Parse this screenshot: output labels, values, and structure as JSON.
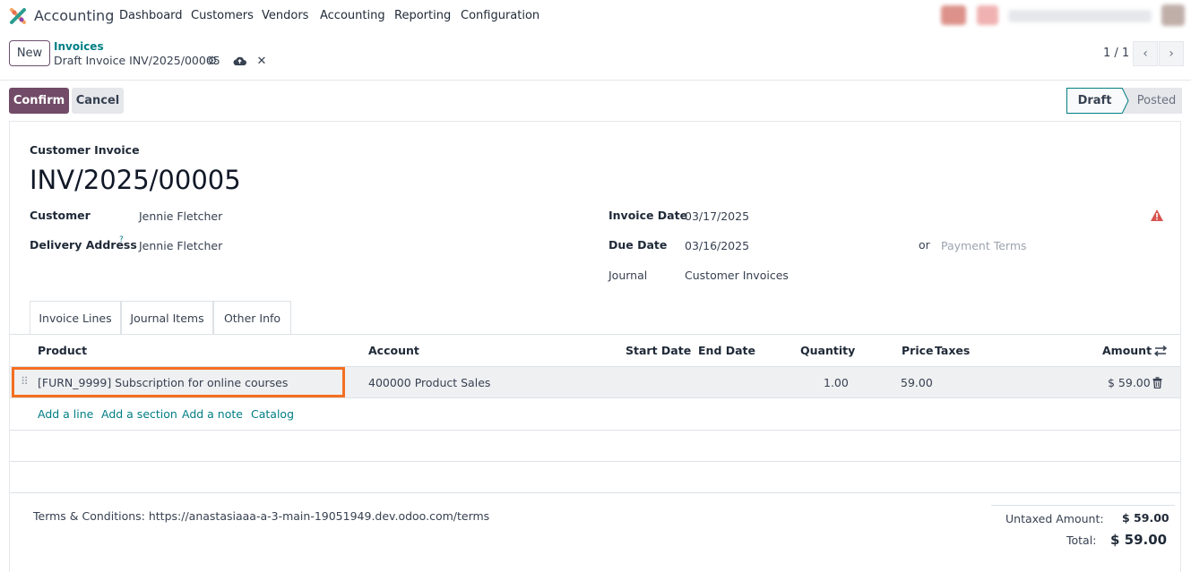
{
  "app": {
    "name": "Accounting",
    "menu": [
      "Dashboard",
      "Customers",
      "Vendors",
      "Accounting",
      "Reporting",
      "Configuration"
    ]
  },
  "control_panel": {
    "new_label": "New",
    "breadcrumb_parent": "Invoices",
    "breadcrumb_current": "Draft Invoice INV/2025/00005",
    "pager": "1 / 1"
  },
  "actions": {
    "confirm_label": "Confirm",
    "cancel_label": "Cancel",
    "status_draft": "Draft",
    "status_posted": "Posted"
  },
  "invoice": {
    "type_label": "Customer Invoice",
    "number": "INV/2025/00005",
    "customer_label": "Customer",
    "customer": "Jennie Fletcher",
    "delivery_label": "Delivery Address",
    "delivery_help": "?",
    "delivery": "Jennie Fletcher",
    "invoice_date_label": "Invoice Date",
    "invoice_date": "03/17/2025",
    "due_date_label": "Due Date",
    "due_date": "03/16/2025",
    "or_text": "or",
    "payment_terms_placeholder": "Payment Terms",
    "journal_label": "Journal",
    "journal": "Customer Invoices"
  },
  "tabs": [
    "Invoice Lines",
    "Journal Items",
    "Other Info"
  ],
  "lines": {
    "headers": {
      "product": "Product",
      "account": "Account",
      "start_date": "Start Date",
      "end_date": "End Date",
      "quantity": "Quantity",
      "price": "Price",
      "taxes": "Taxes",
      "amount": "Amount"
    },
    "rows": [
      {
        "product": "[FURN_9999] Subscription for online courses",
        "account": "400000 Product Sales",
        "start_date": "",
        "end_date": "",
        "quantity": "1.00",
        "price": "59.00",
        "taxes": "",
        "amount": "$ 59.00"
      }
    ],
    "add_links": [
      "Add a line",
      "Add a section",
      "Add a note",
      "Catalog"
    ]
  },
  "footer": {
    "terms": "Terms & Conditions: https://anastasiaaa-a-3-main-19051949.dev.odoo.com/terms",
    "untaxed_label": "Untaxed Amount:",
    "untaxed_value": "$ 59.00",
    "total_label": "Total:",
    "total_value": "$ 59.00"
  },
  "colors": {
    "brand": "#714b67",
    "link": "#017e84",
    "highlight": "#f36f21",
    "warning": "#d9534f"
  }
}
